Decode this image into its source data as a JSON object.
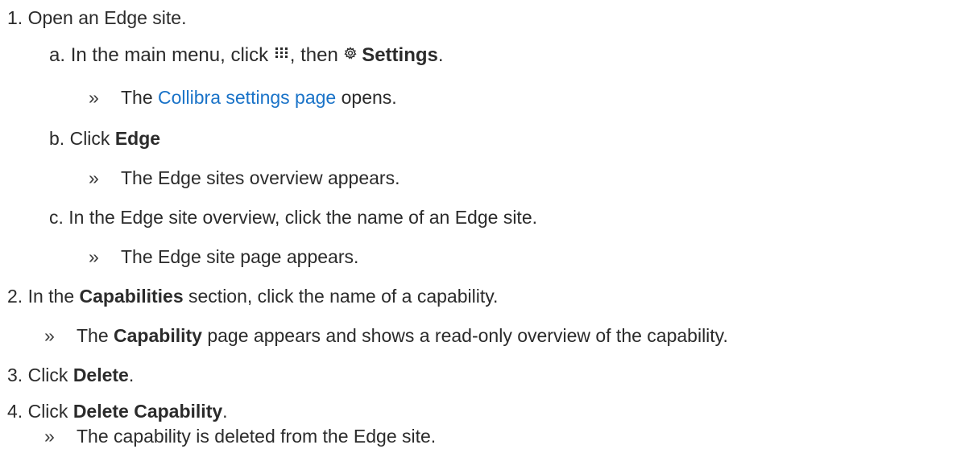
{
  "steps": {
    "s1": {
      "num": "1.",
      "text": "Open an Edge site."
    },
    "s1a": {
      "num": "a.",
      "pre": "In the main menu, click",
      "mid": ", then",
      "settings": "Settings",
      "end": "."
    },
    "s1a_r": {
      "pre": "The",
      "link": "Collibra settings page",
      "post": "opens."
    },
    "s1b": {
      "num": "b.",
      "pre": "Click",
      "bold": "Edge"
    },
    "s1b_r": {
      "text": "The Edge sites overview appears."
    },
    "s1c": {
      "num": "c.",
      "text": "In the Edge site overview, click the name of an Edge site."
    },
    "s1c_r": {
      "text": "The Edge site page appears."
    },
    "s2": {
      "num": "2.",
      "pre": "In the",
      "bold": "Capabilities",
      "post": "section, click the name of a capability."
    },
    "s2_r": {
      "pre": "The",
      "bold": "Capability",
      "post": "page appears and shows a read-only overview of the capability."
    },
    "s3": {
      "num": "3.",
      "pre": "Click",
      "bold": "Delete",
      "end": "."
    },
    "s4": {
      "num": "4.",
      "pre": "Click",
      "bold": "Delete Capability",
      "end": "."
    },
    "s4_r": {
      "text": "The capability is deleted from the Edge site."
    }
  },
  "bullet": "»",
  "icons": {
    "menu": "apps-grid-icon",
    "settings": "gear-icon"
  }
}
